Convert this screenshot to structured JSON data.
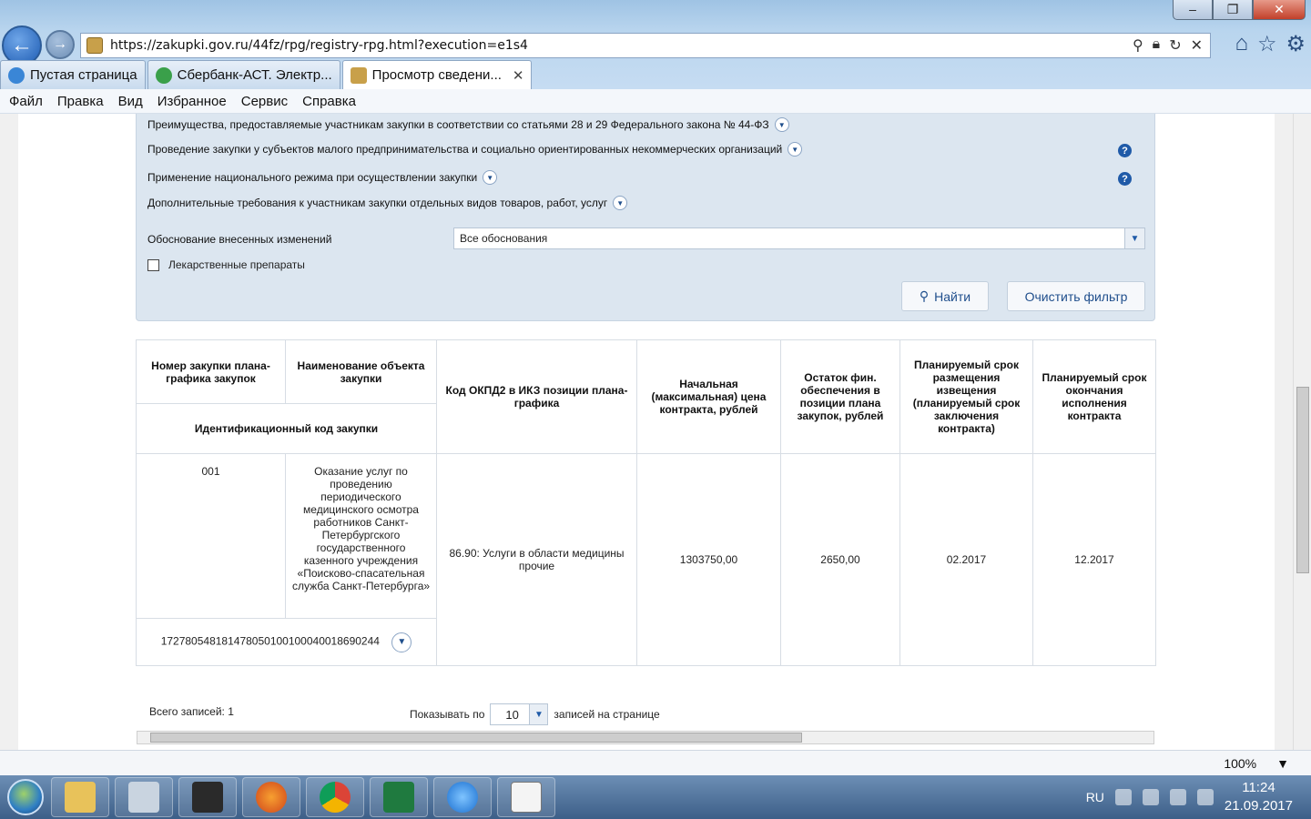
{
  "browser": {
    "url": "https://zakupki.gov.ru/44fz/rpg/registry-rpg.html?execution=e1s4",
    "tabs": [
      {
        "label": "Пустая страница"
      },
      {
        "label": "Сбербанк-АСТ. Электр..."
      },
      {
        "label": "Просмотр сведени..."
      }
    ],
    "menu": [
      "Файл",
      "Правка",
      "Вид",
      "Избранное",
      "Сервис",
      "Справка"
    ]
  },
  "filters": {
    "rows": [
      "Преимущества, предоставляемые участникам закупки в соответствии со статьями 28 и 29 Федерального закона № 44-ФЗ",
      "Проведение закупки у субъектов малого предпринимательства и социально ориентированных некоммерческих организаций",
      "Применение национального режима при осуществлении закупки",
      "Дополнительные требования к участникам закупки отдельных видов товаров, работ, услуг"
    ],
    "reason_label": "Обоснование внесенных изменений",
    "reason_value": "Все обоснования",
    "drugs_label": "Лекарственные препараты",
    "find_label": "Найти",
    "clear_label": "Очистить фильтр"
  },
  "table": {
    "headers": {
      "number": "Номер закупки плана-графика закупок",
      "name": "Наименование объекта закупки",
      "ikz": "Идентификационный код закупки",
      "okpd": "Код ОКПД2 в ИКЗ позиции плана-графика",
      "price": "Начальная (максимальная) цена контракта, рублей",
      "balance": "Остаток фин. обеспечения в позиции плана закупок, рублей",
      "placement": "Планируемый срок размещения извещения (планируемый срок заключения контракта)",
      "end": "Планируемый срок окончания исполнения контракта"
    },
    "rows": [
      {
        "number": "001",
        "name": "Оказание услуг по проведению периодического медицинского осмотра работников Санкт-Петербургского государственного казенного учреждения «Поисково-спасательная служба Санкт-Петербурга»",
        "ikz": "172780548181478050100100040018690244",
        "okpd": "86.90: Услуги в области медицины прочие",
        "price": "1303750,00",
        "balance": "2650,00",
        "placement": "02.2017",
        "end": "12.2017"
      }
    ]
  },
  "pager": {
    "total": "Всего записей: 1",
    "show_label": "Показывать по",
    "per_page": "10",
    "per_page_suffix": "записей на странице"
  },
  "status": {
    "zoom": "100%"
  },
  "taskbar": {
    "lang": "RU",
    "time": "11:24",
    "date": "21.09.2017"
  }
}
